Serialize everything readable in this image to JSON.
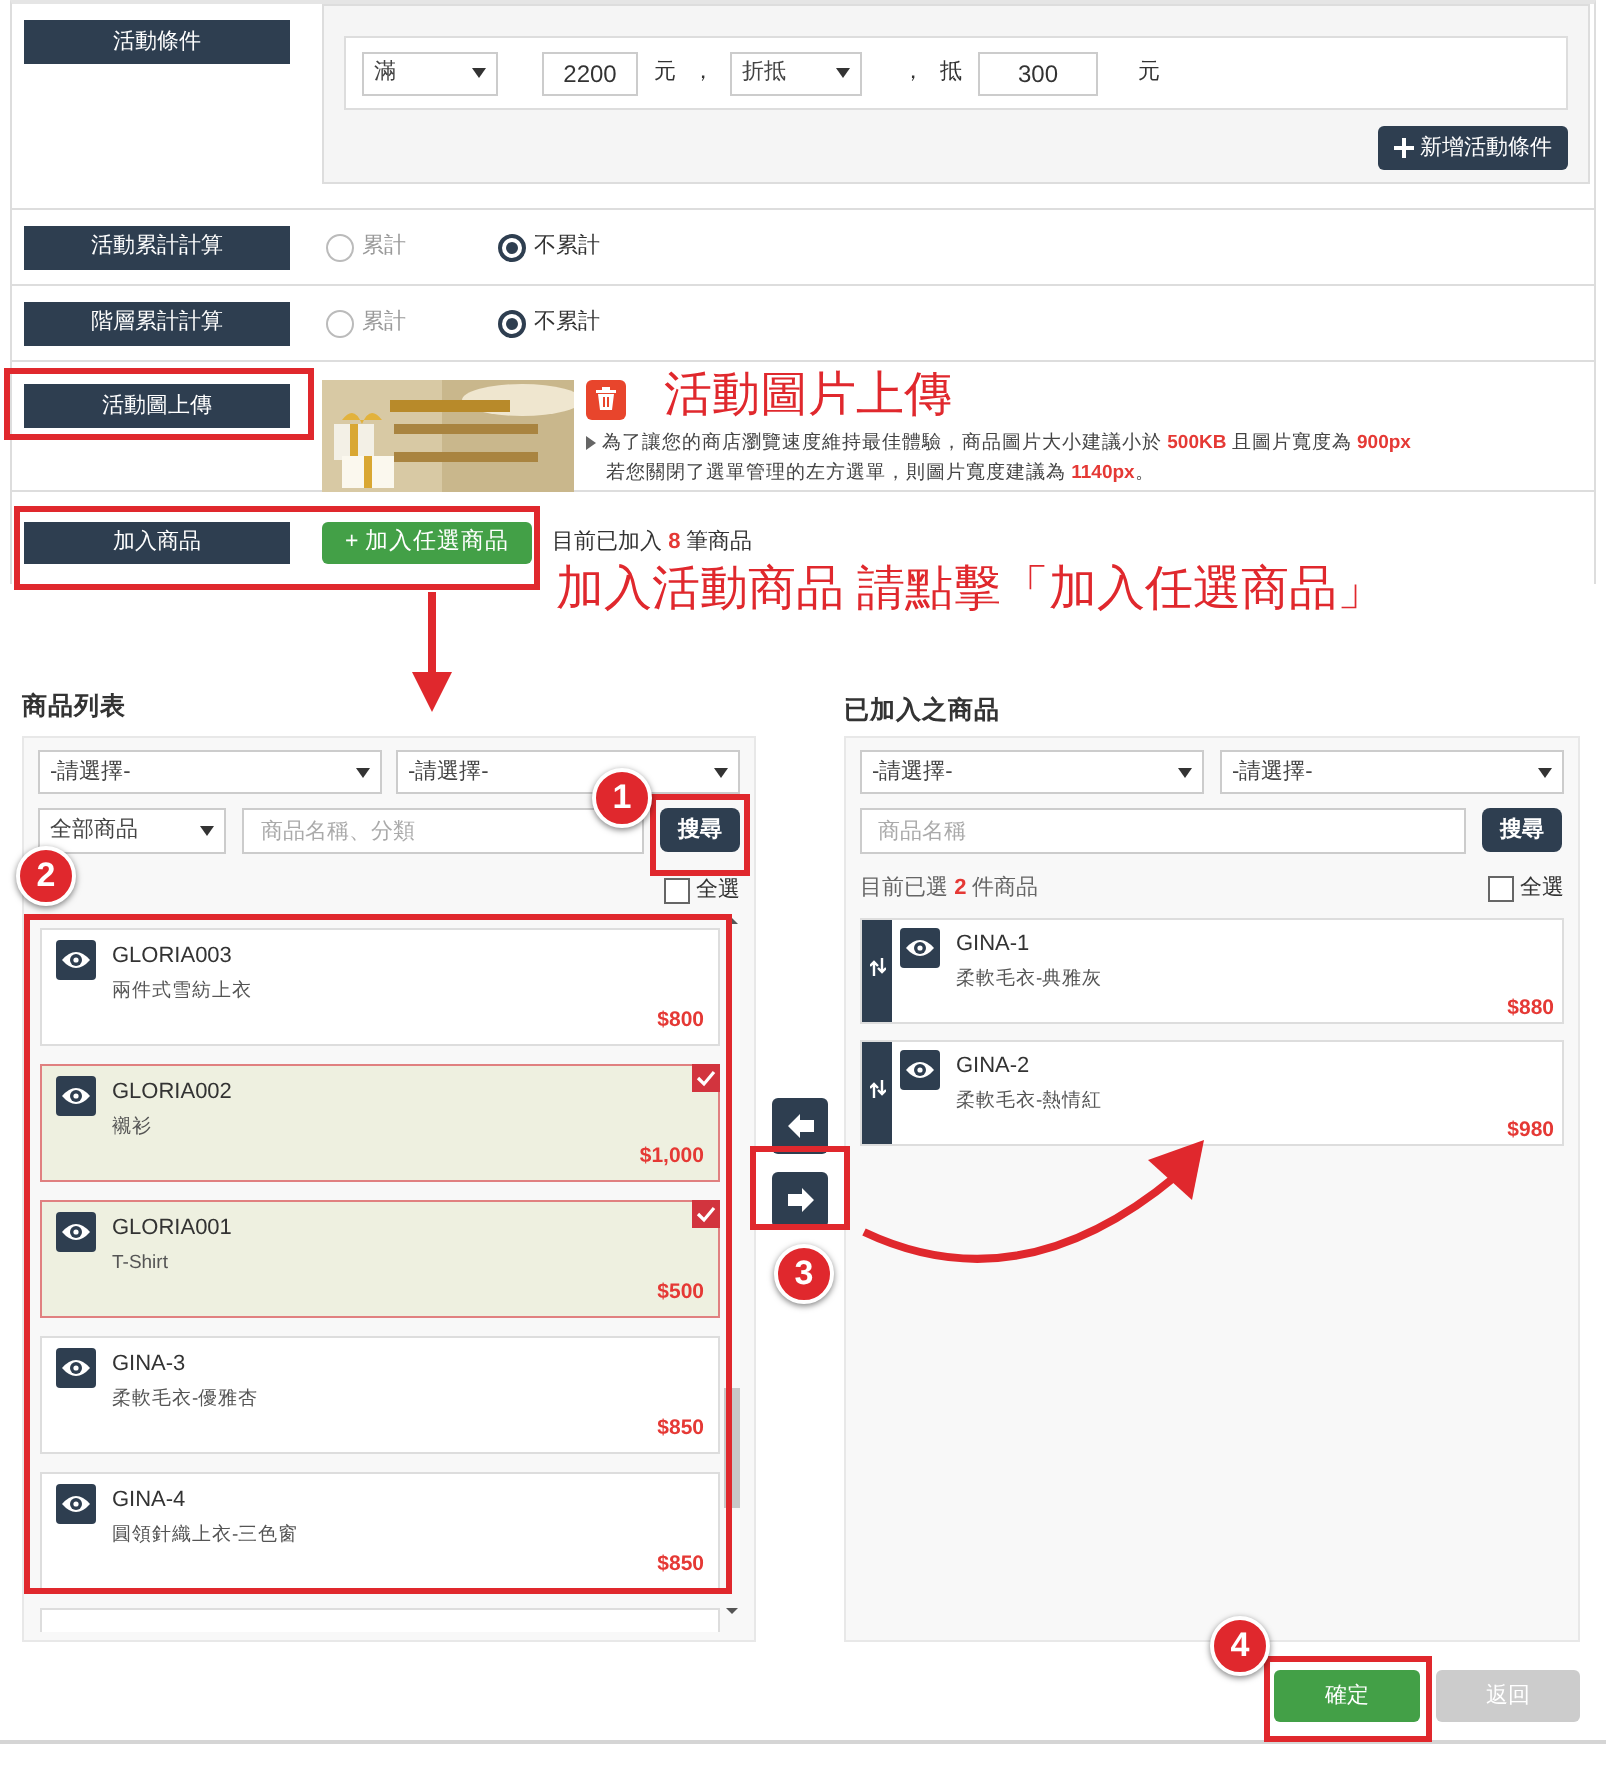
{
  "conditions": {
    "label": "活動條件",
    "rules": [
      {
        "type_select": "滿",
        "amount": "2200",
        "unit": "元",
        "sep1": "，",
        "mode_select": "折抵",
        "sep2": "，",
        "deduct_label": "抵",
        "deduct": "300",
        "unit2": "元"
      }
    ],
    "add_button": "新增活動條件"
  },
  "radio_rows": [
    {
      "label": "活動累計計算",
      "options": [
        {
          "label": "累計",
          "selected": false
        },
        {
          "label": "不累計",
          "selected": true
        }
      ]
    },
    {
      "label": "階層累計計算",
      "options": [
        {
          "label": "累計",
          "selected": false
        },
        {
          "label": "不累計",
          "selected": true
        }
      ]
    }
  ],
  "image_upload": {
    "label": "活動圖上傳",
    "notes": [
      "為了讓您的商店瀏覽速度維持最佳體驗，商品圖片大小建議小於 **500KB** 且圖片寬度為 **900px**",
      "若您關閉了選單管理的左方選單，則圖片寬度建議為 **1140px**。"
    ]
  },
  "add_products": {
    "label": "加入商品",
    "button": "+ 加入任選商品",
    "count_text": "目前已加入 **8** 筆商品"
  },
  "product_list": {
    "title": "商品列表",
    "filters": [
      "-請選擇-",
      "-請選擇-"
    ],
    "category": "全部商品",
    "search_placeholder": "商品名稱、分類",
    "search_button": "搜尋",
    "select_all": {
      "label": "全選",
      "checked": false
    },
    "items": [
      {
        "code": "GLORIA003",
        "name": "兩件式雪紡上衣",
        "price": "$800",
        "selected": false
      },
      {
        "code": "GLORIA002",
        "name": "襯衫",
        "price": "$1,000",
        "selected": true
      },
      {
        "code": "GLORIA001",
        "name": "T-Shirt",
        "price": "$500",
        "selected": true
      },
      {
        "code": "GINA-3",
        "name": "柔軟毛衣-優雅杏",
        "price": "$850",
        "selected": false
      },
      {
        "code": "GINA-4",
        "name": "圓領針織上衣-三色窗",
        "price": "$850",
        "selected": false
      }
    ]
  },
  "added_list": {
    "title": "已加入之商品",
    "filters": [
      "-請選擇-",
      "-請選擇-"
    ],
    "search_placeholder": "商品名稱",
    "search_button": "搜尋",
    "count_text": "目前已選 **2** 件商品",
    "select_all": {
      "label": "全選",
      "checked": false
    },
    "items": [
      {
        "code": "GINA-1",
        "name": "柔軟毛衣-典雅灰",
        "price": "$880"
      },
      {
        "code": "GINA-2",
        "name": "柔軟毛衣-熱情紅",
        "price": "$980"
      }
    ]
  },
  "footer": {
    "confirm": "確定",
    "back": {
      "label": "返回",
      "disabled": true
    }
  },
  "annotations": {
    "callouts": [
      "活動圖片上傳",
      "加入活動商品 請點擊「加入任選商品」"
    ],
    "steps": [
      "1",
      "2",
      "3",
      "4"
    ]
  }
}
